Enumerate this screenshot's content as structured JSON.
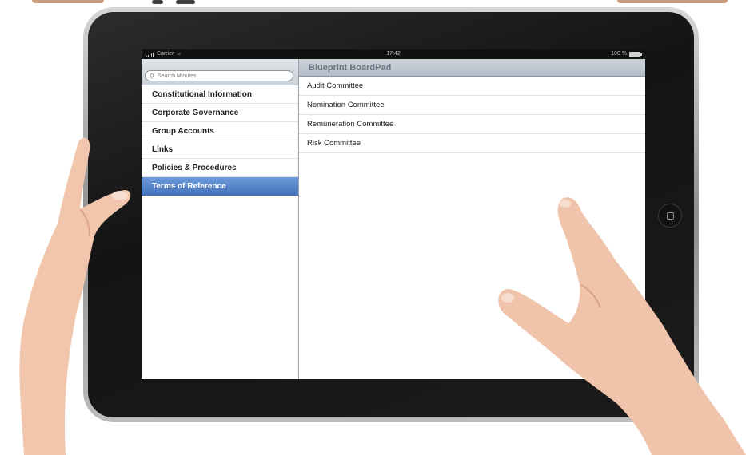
{
  "status_bar": {
    "carrier": "Carrier",
    "time": "17:42",
    "battery": "100 %"
  },
  "sidebar": {
    "search_placeholder": "Search Minutes",
    "items": [
      {
        "label": "Constitutional Information"
      },
      {
        "label": "Corporate Governance"
      },
      {
        "label": "Group Accounts"
      },
      {
        "label": "Links"
      },
      {
        "label": "Policies & Procedures"
      },
      {
        "label": "Terms of Reference",
        "selected": true
      }
    ]
  },
  "detail": {
    "title": "Blueprint BoardPad",
    "items": [
      {
        "label": "Audit Committee"
      },
      {
        "label": "Nomination Committee"
      },
      {
        "label": "Remuneration Committee"
      },
      {
        "label": "Risk Committee"
      }
    ]
  },
  "colors": {
    "selected_row": "#4f7fc6",
    "bezel": "#1a1a1a",
    "skin": "#f0c6ad"
  },
  "icons": [
    "signal-bars-icon",
    "wifi-icon",
    "battery-icon",
    "search-icon",
    "home-button-icon"
  ]
}
